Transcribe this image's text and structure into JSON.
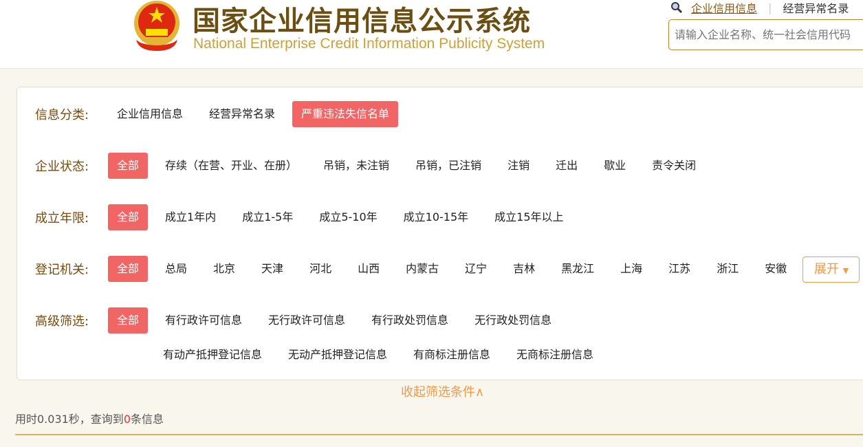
{
  "header": {
    "title_cn": "国家企业信用信息公示系统",
    "title_en": "National Enterprise Credit Information Publicity System",
    "top_links": [
      "企业信用信息",
      "经营异常名录"
    ],
    "search_placeholder": "请输入企业名称、统一社会信用代码"
  },
  "filters": {
    "info_category": {
      "label": "信息分类:",
      "items": [
        "企业信用信息",
        "经营异常名录",
        "严重违法失信名单"
      ],
      "active": 2
    },
    "status": {
      "label": "企业状态:",
      "items": [
        "全部",
        "存续（在营、开业、在册）",
        "吊销，未注销",
        "吊销，已注销",
        "注销",
        "迁出",
        "歇业",
        "责令关闭"
      ],
      "active": 0
    },
    "age": {
      "label": "成立年限:",
      "items": [
        "全部",
        "成立1年内",
        "成立1-5年",
        "成立5-10年",
        "成立10-15年",
        "成立15年以上"
      ],
      "active": 0
    },
    "authority": {
      "label": "登记机关:",
      "items": [
        "全部",
        "总局",
        "北京",
        "天津",
        "河北",
        "山西",
        "内蒙古",
        "辽宁",
        "吉林",
        "黑龙江",
        "上海",
        "江苏",
        "浙江",
        "安徽"
      ],
      "active": 0,
      "expand_label": "展开"
    },
    "advanced": {
      "label": "高级筛选:",
      "items": [
        "全部",
        "有行政许可信息",
        "无行政许可信息",
        "有行政处罚信息",
        "无行政处罚信息"
      ],
      "items2": [
        "有动产抵押登记信息",
        "无动产抵押登记信息",
        "有商标注册信息",
        "无商标注册信息"
      ],
      "active": 0
    }
  },
  "collapse_label": "收起筛选条件∧",
  "result": {
    "prefix": "用时0.031秒，查询到",
    "count": "0",
    "suffix": "条信息"
  },
  "colors": {
    "accent_red": "#f26565",
    "label_brown": "#7a4a0e",
    "orange": "#f09a4a"
  }
}
